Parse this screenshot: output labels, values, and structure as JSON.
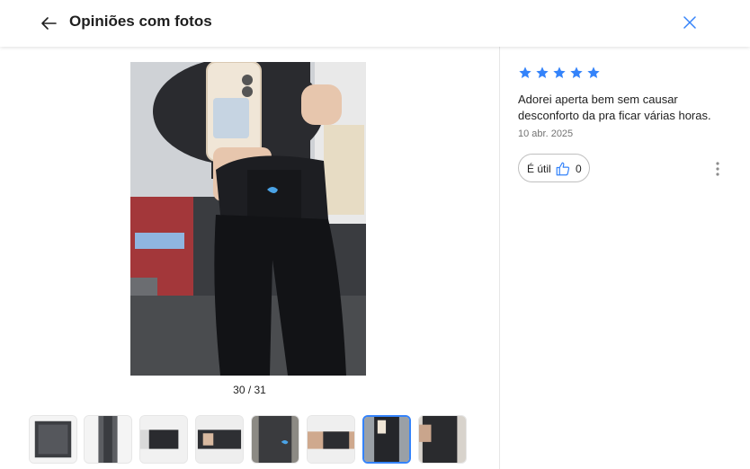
{
  "header": {
    "title": "Opiniões com fotos",
    "back_icon": "arrow-left-icon",
    "close_icon": "close-icon",
    "accent": "#3483fa"
  },
  "gallery": {
    "counter": "30 / 31",
    "current_index": 30,
    "total": 31,
    "thumbnails": [
      {
        "id": "thumb-1",
        "active": false
      },
      {
        "id": "thumb-2",
        "active": false
      },
      {
        "id": "thumb-3",
        "active": false
      },
      {
        "id": "thumb-4",
        "active": false
      },
      {
        "id": "thumb-5",
        "active": false
      },
      {
        "id": "thumb-6",
        "active": false
      },
      {
        "id": "thumb-7",
        "active": true
      },
      {
        "id": "thumb-8",
        "active": false
      }
    ]
  },
  "review": {
    "rating": 5,
    "max_rating": 5,
    "star_color": "#3483fa",
    "text": "Adorei aperta bem sem causar desconforto da pra ficar várias horas.",
    "date": "10 abr. 2025",
    "useful_label": "É útil",
    "useful_count": "0",
    "more_icon": "more-vertical-icon"
  }
}
